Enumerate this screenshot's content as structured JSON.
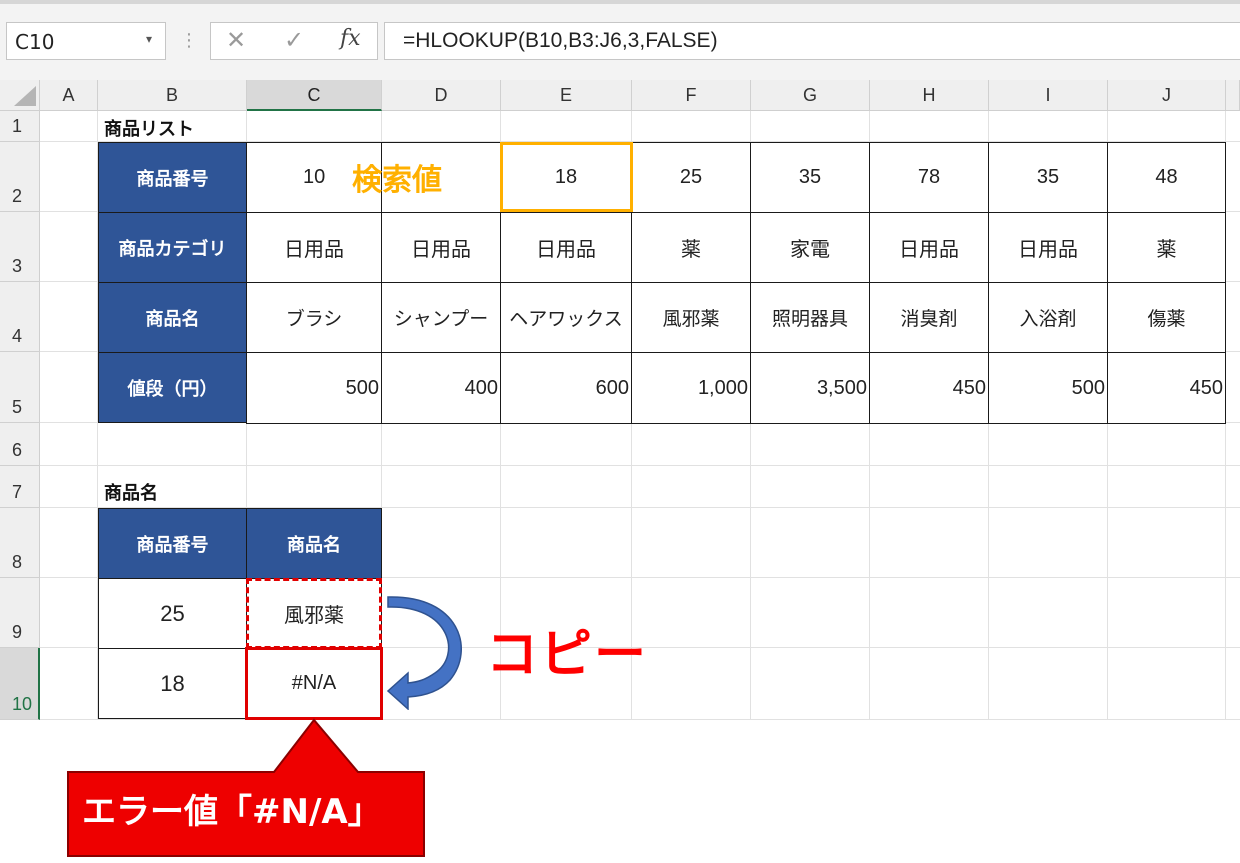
{
  "formula_bar": {
    "name_box": "C10",
    "formula": "=HLOOKUP(B10,B3:J6,3,FALSE)"
  },
  "columns": [
    "A",
    "B",
    "C",
    "D",
    "E",
    "F",
    "G",
    "H",
    "I",
    "J"
  ],
  "rows": [
    "1",
    "2",
    "3",
    "4",
    "5",
    "6",
    "7",
    "8",
    "9",
    "10"
  ],
  "table1": {
    "title": "商品リスト",
    "row_headers": [
      "商品番号",
      "商品カテゴリ",
      "商品名",
      "値段（円）"
    ],
    "numbers": [
      "10",
      "",
      "18",
      "25",
      "35",
      "78",
      "35",
      "48"
    ],
    "categories": [
      "日用品",
      "日用品",
      "日用品",
      "薬",
      "家電",
      "日用品",
      "日用品",
      "薬"
    ],
    "names": [
      "ブラシ",
      "シャンプー",
      "ヘアワックス",
      "風邪薬",
      "照明器具",
      "消臭剤",
      "入浴剤",
      "傷薬"
    ],
    "prices": [
      "500",
      "400",
      "600",
      "1,000",
      "3,500",
      "450",
      "500",
      "450"
    ]
  },
  "table2": {
    "title": "商品名",
    "headers": [
      "商品番号",
      "商品名"
    ],
    "rows": [
      {
        "number": "25",
        "name": "風邪薬"
      },
      {
        "number": "18",
        "name": "#N/A"
      }
    ]
  },
  "annotations": {
    "search_value": "検索値",
    "copy": "コピー",
    "error_callout": "エラー値「#N/A」"
  },
  "colors": {
    "header_blue": "#2f5597",
    "highlight_orange": "#ffb000",
    "annotation_red": "#ff0000",
    "callout_red": "#ee0000",
    "arrow_blue": "#4472c4"
  }
}
